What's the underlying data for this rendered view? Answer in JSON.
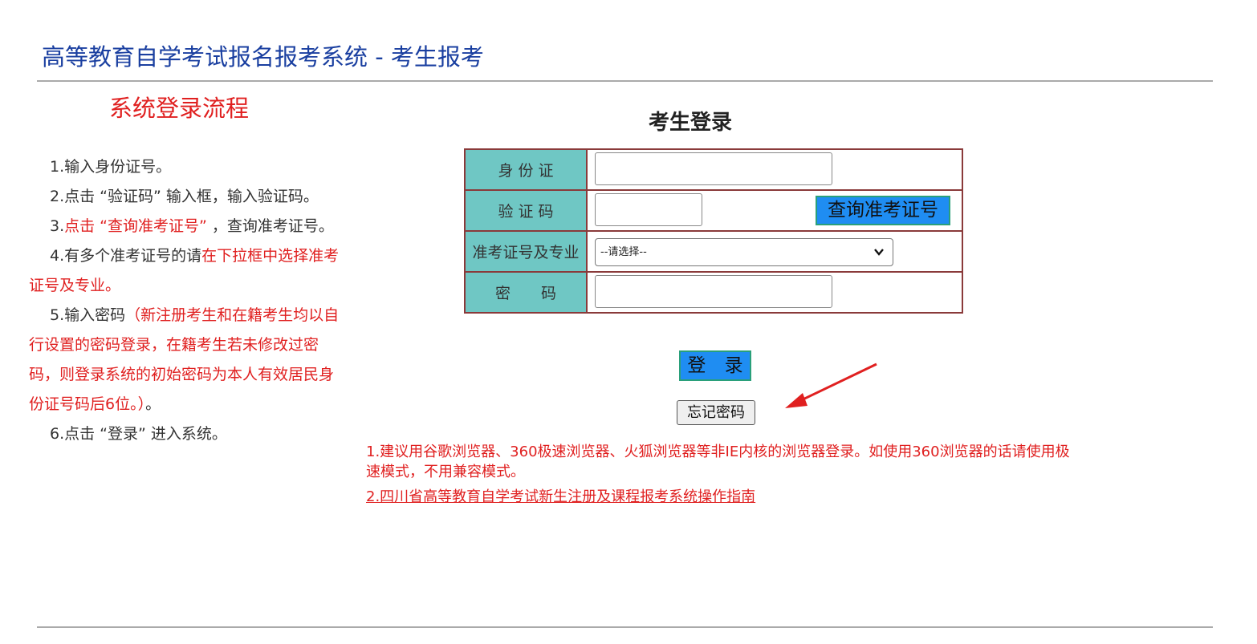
{
  "header": {
    "title": "高等教育自学考试报名报考系统 - 考生报考"
  },
  "procedure": {
    "title": "系统登录流程",
    "step1": "1.输入身份证号。",
    "step2": "2.点击 “验证码” 输入框，输入验证码。",
    "step3_prefix": "3.",
    "step3_red": "点击 “查询准考证号”",
    "step3_suffix": " ，查询准考证号。",
    "step4_prefix": "4.有多个准考证号的请",
    "step4_red": "在下拉框中选择准考证号及专业。",
    "step5_prefix": "5.输入密码",
    "step5_red": "（新注册考生和在籍考生均以自行设置的密码登录，在籍考生若未修改过密码，则登录系统的初始密码为本人有效居民身份证号码后6位。）",
    "step5_suffix": "。",
    "step6": "6.点击 “登录” 进入系统。"
  },
  "login": {
    "title": "考生登录",
    "id_label": "身 份 证",
    "id_value": "",
    "code_label": "验 证 码",
    "code_value": "",
    "query_button": "查询准考证号",
    "exam_label": "准考证号及专业",
    "exam_selected": "--请选择--",
    "pwd_label": "密　　码",
    "pwd_value": "",
    "login_button": "登 录",
    "forgot_button": "忘记密码"
  },
  "notes": {
    "note1": "1.建议用谷歌浏览器、360极速浏览器、火狐浏览器等非IE内核的浏览器登录。如使用360浏览器的话请使用极速模式，不用兼容模式。",
    "note2_link": "2.四川省高等教育自学考试新生注册及课程报考系统操作指南"
  },
  "colors": {
    "header_blue": "#1a3fa0",
    "accent_red": "#e02020",
    "label_teal": "#6fc7c4",
    "button_blue": "#1f8df2",
    "table_border": "#8a3a3a"
  }
}
